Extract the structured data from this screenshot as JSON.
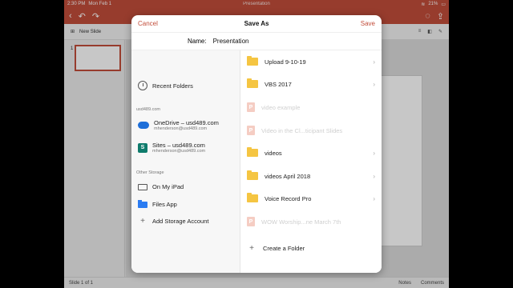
{
  "status": {
    "time": "2:30 PM",
    "date": "Mon Feb 1",
    "doc_title": "Presentation",
    "battery": "21%"
  },
  "toolbar": {
    "new_slide": "New Slide",
    "slide_counter": "Slide 1 of 1",
    "notes": "Notes",
    "comments": "Comments"
  },
  "thumb": {
    "number": "1"
  },
  "dialog": {
    "cancel": "Cancel",
    "title": "Save As",
    "save": "Save",
    "name_label": "Name:",
    "name_value": "Presentation",
    "left": {
      "recent": "Recent Folders",
      "account_section": "usd489.com",
      "onedrive_name": "OneDrive – usd489.com",
      "onedrive_email": "mhenderson@usd489.com",
      "sites_name": "Sites – usd489.com",
      "sites_email": "mhenderson@usd489.com",
      "other_section": "Other Storage",
      "ipad": "On My iPad",
      "files": "Files App",
      "add_account": "Add Storage Account"
    },
    "folders": [
      {
        "label": "Upload 9-10-19",
        "type": "folder"
      },
      {
        "label": "VBS 2017",
        "type": "folder"
      },
      {
        "label": "video example",
        "type": "file"
      },
      {
        "label": "Video in the Cl...ticipant Slides",
        "type": "file"
      },
      {
        "label": "videos",
        "type": "folder"
      },
      {
        "label": "videos April 2018",
        "type": "folder"
      },
      {
        "label": "Voice Record Pro",
        "type": "folder"
      },
      {
        "label": "WOW Worship...ne March 7th",
        "type": "file"
      }
    ],
    "create_folder": "Create a Folder"
  },
  "colors": {
    "accent": "#c24d3a",
    "folder": "#f5c542"
  }
}
